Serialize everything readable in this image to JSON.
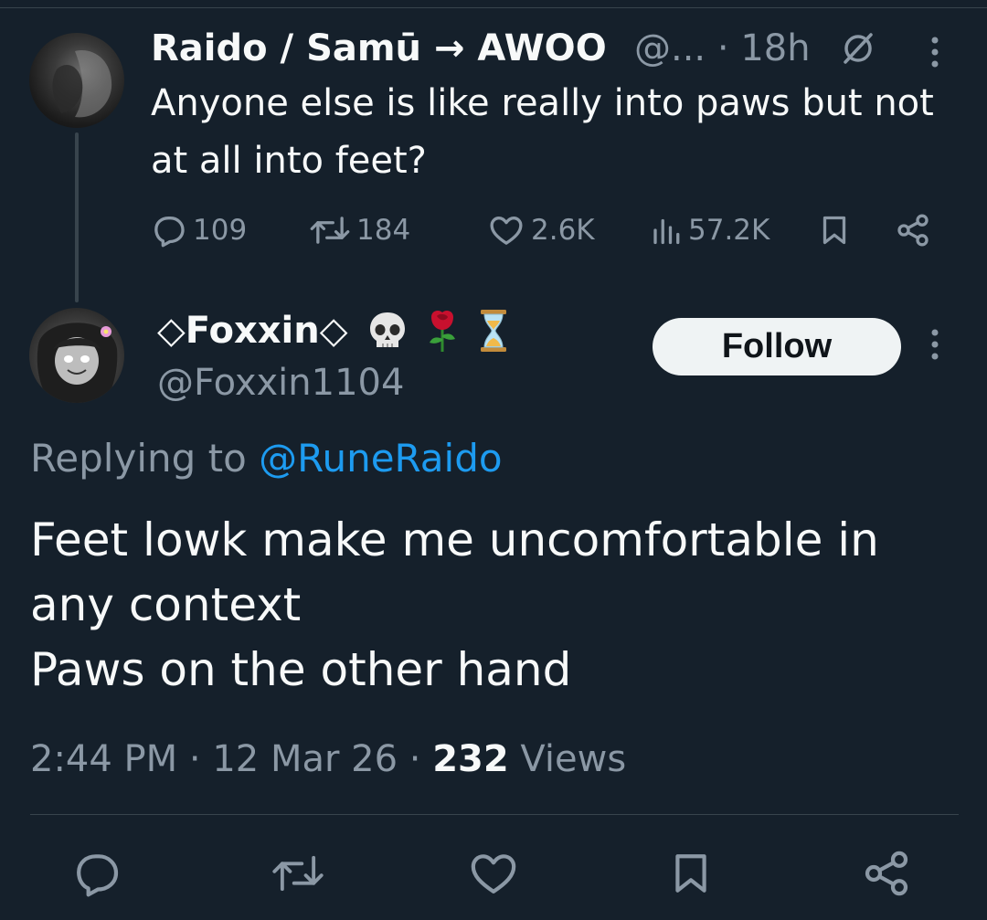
{
  "parent_tweet": {
    "display_name": "Raido / Samū → AWOO",
    "handle_truncated": "@...",
    "separator": "·",
    "time_ago": "18h",
    "text": "Anyone else is like really into paws but not at all into feet?",
    "stats": {
      "replies": "109",
      "reposts": "184",
      "likes": "2.6K",
      "views": "57.2K"
    },
    "icons": [
      "muted-circle-slash-icon",
      "more-vertical-icon",
      "reply-icon",
      "repost-icon",
      "like-icon",
      "views-chart-icon",
      "bookmark-icon",
      "share-icon"
    ]
  },
  "reply_tweet": {
    "display_name": "◇Foxxin◇",
    "emojis": [
      "skull",
      "rose",
      "hourglass"
    ],
    "handle": "@Foxxin1104",
    "follow_label": "Follow",
    "replying_prefix": "Replying to",
    "replying_handle": "@RuneRaido",
    "text_lines": [
      "Feet lowk make me uncomfortable in",
      "any context",
      "Paws on the other hand"
    ],
    "time": "2:44 PM",
    "dot": "·",
    "date": "12 Mar 26",
    "views_count": "232",
    "views_label": "Views"
  },
  "bottom_actions": [
    "reply-icon",
    "repost-icon",
    "like-icon",
    "bookmark-icon",
    "share-icon"
  ],
  "colors": {
    "background": "#15202b",
    "text": "#f7f9f9",
    "secondary": "#8b98a5",
    "accent": "#1d9bf0",
    "divider": "#38444d",
    "follow_bg": "#eff3f4"
  }
}
